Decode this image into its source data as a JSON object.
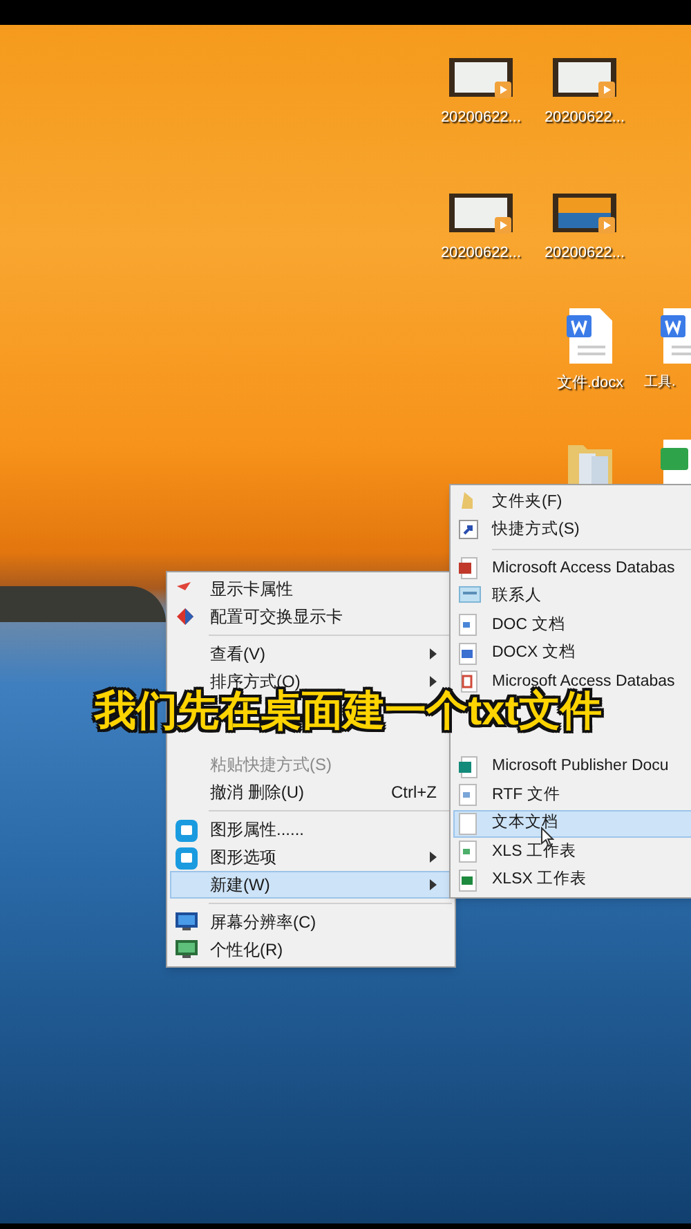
{
  "desktop_icons": [
    {
      "kind": "video",
      "label": "20200622..."
    },
    {
      "kind": "video",
      "label": "20200622..."
    },
    {
      "kind": "video",
      "label": "20200622..."
    },
    {
      "kind": "video_sunset",
      "label": "20200622..."
    },
    {
      "kind": "word",
      "label": "文件.docx"
    },
    {
      "kind": "word",
      "label": "工具."
    },
    {
      "kind": "folder"
    },
    {
      "kind": "sheet"
    }
  ],
  "context_menu": {
    "items": [
      {
        "kind": "item",
        "label": "显示卡属性",
        "disabled": false,
        "selected": false,
        "submenu": false
      },
      {
        "kind": "item",
        "label": "配置可交换显示卡",
        "disabled": false,
        "selected": false,
        "submenu": false
      },
      {
        "kind": "separator"
      },
      {
        "kind": "item",
        "label": "查看(V)",
        "disabled": false,
        "selected": false,
        "submenu": true
      },
      {
        "kind": "item",
        "label": "排序方式(O)",
        "disabled": false,
        "selected": false,
        "submenu": true
      },
      {
        "kind": "hidden"
      },
      {
        "kind": "hidden"
      },
      {
        "kind": "item",
        "label": "粘贴快捷方式(S)",
        "disabled": true,
        "selected": false,
        "submenu": false
      },
      {
        "kind": "item",
        "label": "撤消 删除(U)",
        "shortcut": "Ctrl+Z",
        "disabled": false,
        "selected": false,
        "submenu": false
      },
      {
        "kind": "separator"
      },
      {
        "kind": "item",
        "label": "图形属性......",
        "disabled": false,
        "selected": false,
        "submenu": false
      },
      {
        "kind": "item",
        "label": "图形选项",
        "disabled": false,
        "selected": false,
        "submenu": true
      },
      {
        "kind": "item",
        "label": "新建(W)",
        "disabled": false,
        "selected": true,
        "submenu": true
      },
      {
        "kind": "separator"
      },
      {
        "kind": "item",
        "label": "屏幕分辨率(C)",
        "disabled": false,
        "selected": false,
        "submenu": false
      },
      {
        "kind": "item",
        "label": "个性化(R)",
        "disabled": false,
        "selected": false,
        "submenu": false
      }
    ]
  },
  "new_submenu": {
    "items": [
      {
        "kind": "item",
        "label": "文件夹(F)",
        "selected": false
      },
      {
        "kind": "item",
        "label": "快捷方式(S)",
        "selected": false
      },
      {
        "kind": "separator"
      },
      {
        "kind": "item",
        "label": "Microsoft Access Databas",
        "selected": false
      },
      {
        "kind": "item",
        "label": "联系人",
        "selected": false
      },
      {
        "kind": "item",
        "label": "DOC 文档",
        "selected": false
      },
      {
        "kind": "item",
        "label": "DOCX 文档",
        "selected": false
      },
      {
        "kind": "item",
        "label": "Microsoft Access Databas",
        "selected": false
      },
      {
        "kind": "hidden"
      },
      {
        "kind": "hidden"
      },
      {
        "kind": "item",
        "label": "Microsoft Publisher Docu",
        "selected": false
      },
      {
        "kind": "item",
        "label": "RTF 文件",
        "selected": false
      },
      {
        "kind": "item",
        "label": "文本文档",
        "selected": true
      },
      {
        "kind": "item",
        "label": "XLS 工作表",
        "selected": false
      },
      {
        "kind": "item",
        "label": "XLSX 工作表",
        "selected": false
      }
    ]
  },
  "caption": "我们先在桌面建一个txt文件"
}
